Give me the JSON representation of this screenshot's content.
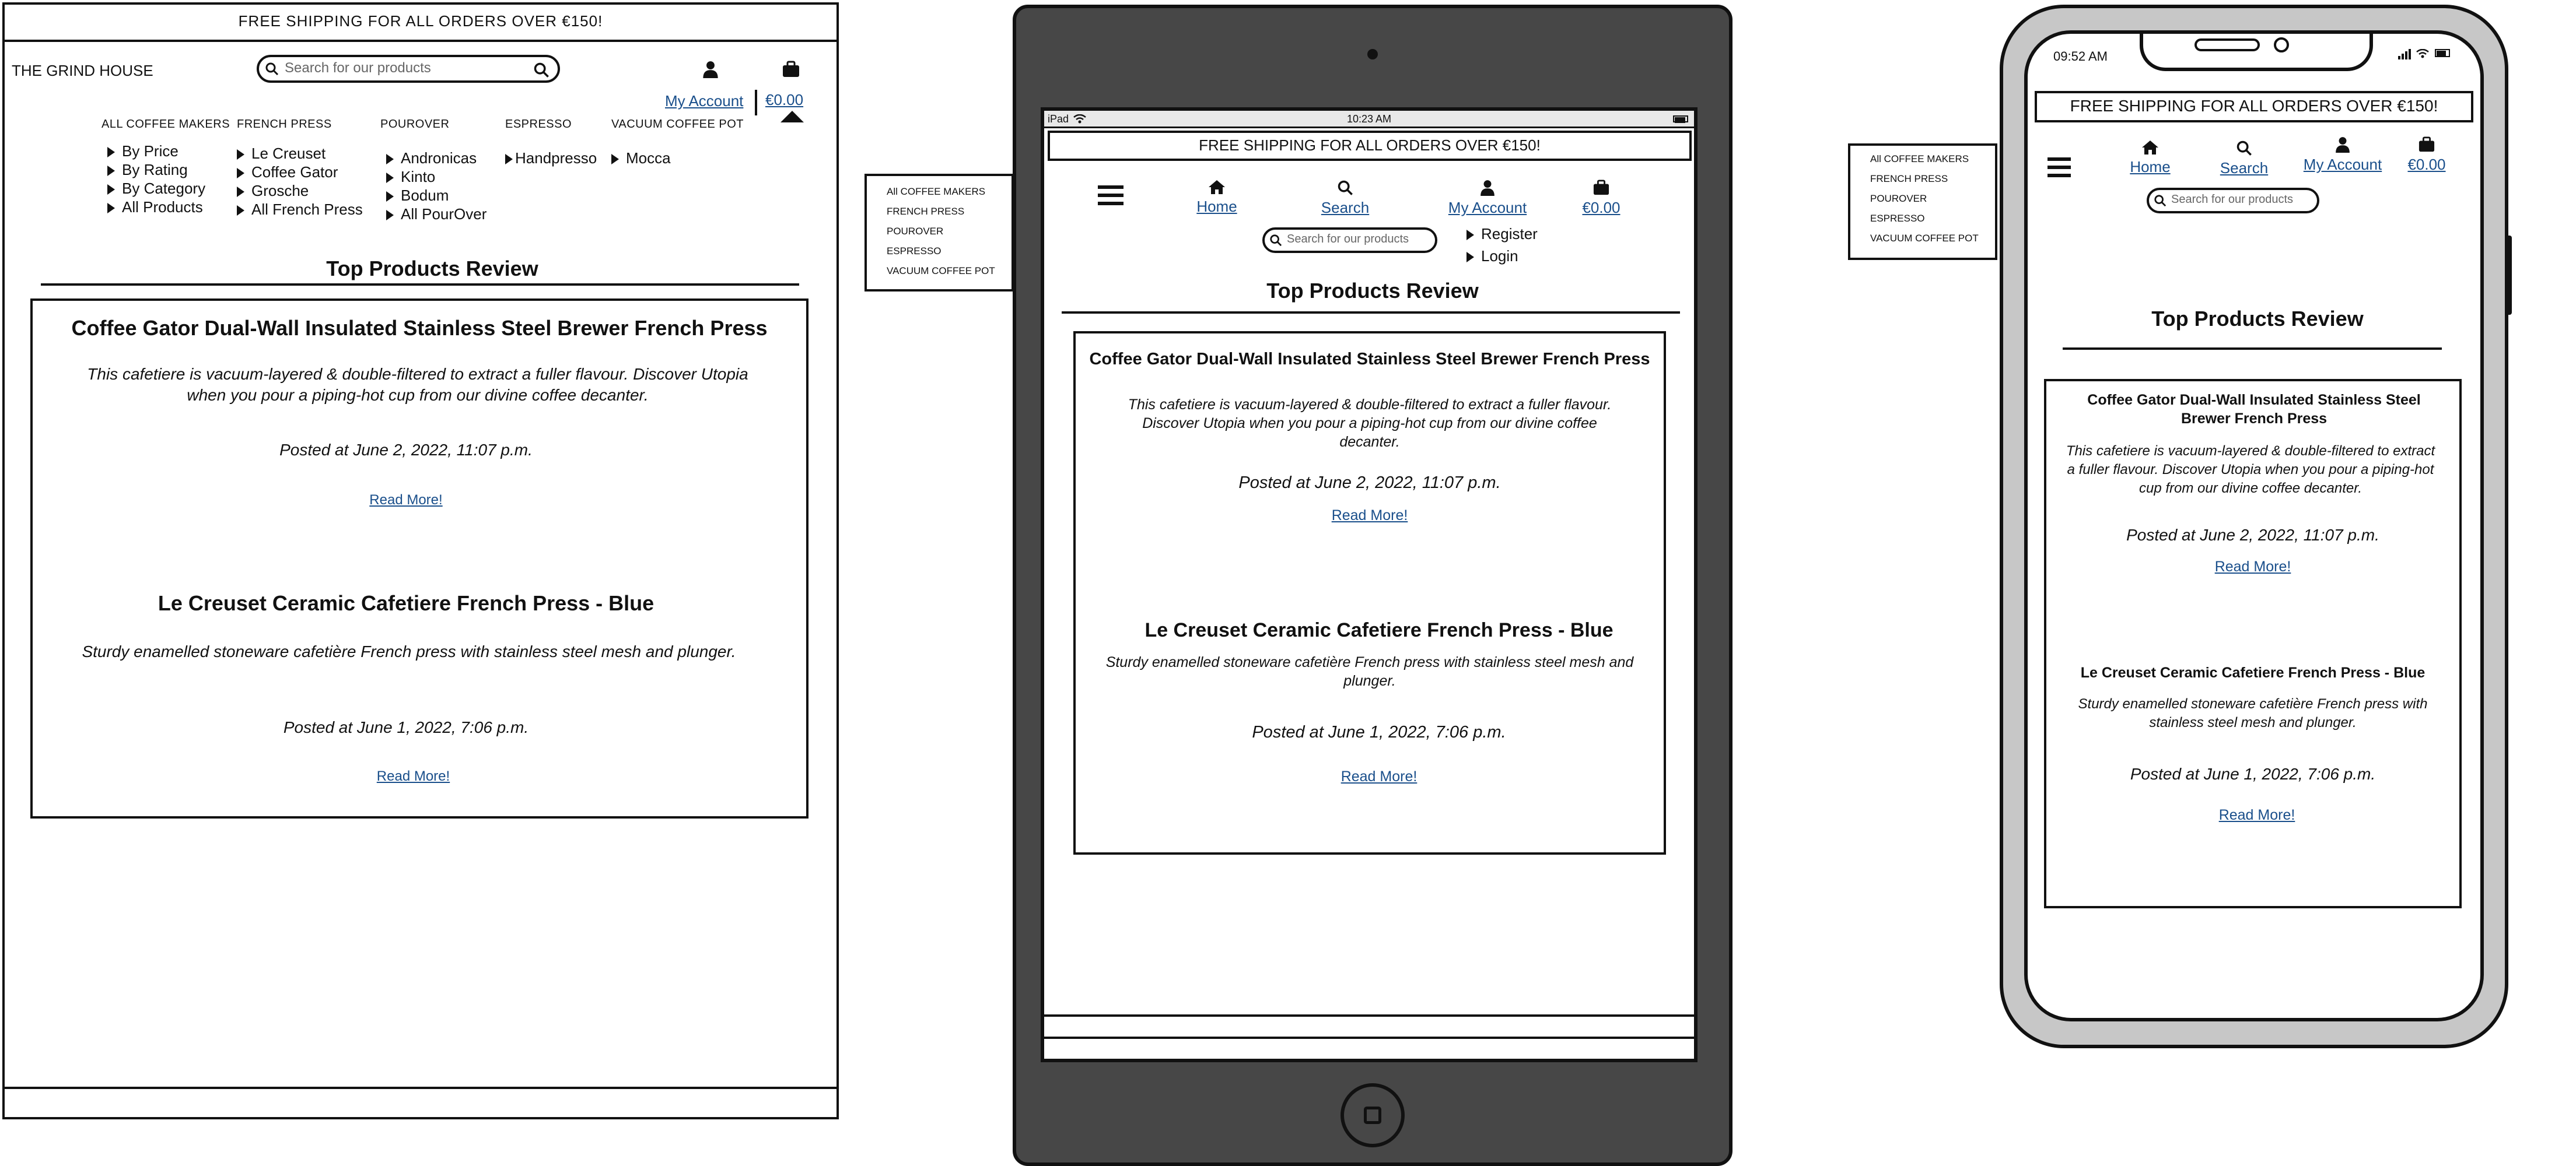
{
  "desktop": {
    "banner": "FREE SHIPPING FOR ALL ORDERS OVER €150!",
    "brand": "THE GRIND HOUSE",
    "search_placeholder": "Search for our products",
    "my_account": "My Account",
    "cart_total": "€0.00",
    "menu": [
      {
        "title": "ALL COFFEE MAKERS",
        "items": [
          "By Price",
          "By Rating",
          "By Category",
          "All Products"
        ]
      },
      {
        "title": "FRENCH PRESS",
        "items": [
          "Le Creuset",
          "Coffee Gator",
          "Grosche",
          "All French Press"
        ]
      },
      {
        "title": "POUROVER",
        "items": [
          "Andronicas",
          "Kinto",
          "Bodum",
          "All PourOver"
        ]
      },
      {
        "title": "ESPRESSO",
        "items": [
          "Handpresso"
        ]
      },
      {
        "title": "VACUUM COFFEE POT",
        "items": [
          "Mocca"
        ]
      }
    ],
    "section_title": "Top Products Review",
    "posts": [
      {
        "title": "Coffee Gator Dual-Wall Insulated Stainless Steel Brewer French Press",
        "body": "This cafetiere is vacuum-layered & double-filtered to extract a fuller flavour. Discover Utopia when you pour a piping-hot cup from our divine coffee decanter.",
        "date": "Posted at June 2, 2022, 11:07 p.m.",
        "read_more": "Read More!"
      },
      {
        "title": "Le Creuset Ceramic Cafetiere French Press - Blue",
        "body": "Sturdy enamelled stoneware cafetière French press with stainless steel mesh and plunger.",
        "date": "Posted at June 1, 2022, 7:06 p.m.",
        "read_more": "Read More!"
      }
    ]
  },
  "tablet_dropdown": [
    "All COFFEE MAKERS",
    "FRENCH PRESS",
    "POUROVER",
    "ESPRESSO",
    "VACUUM COFFEE POT"
  ],
  "tablet": {
    "status_left": "iPad",
    "status_time": "10:23 AM",
    "banner": "FREE SHIPPING FOR ALL ORDERS OVER €150!",
    "nav": {
      "home": "Home",
      "search": "Search",
      "account": "My Account",
      "cart": "€0.00"
    },
    "search_placeholder": "Search for our products",
    "account_menu": [
      "Register",
      "Login"
    ],
    "section_title": "Top Products Review",
    "posts": [
      {
        "title": "Coffee Gator Dual-Wall Insulated Stainless Steel Brewer French Press",
        "body": "This cafetiere is vacuum-layered & double-filtered to extract a fuller flavour. Discover Utopia when you pour a piping-hot cup from our divine coffee decanter.",
        "date": "Posted at June 2, 2022, 11:07 p.m.",
        "read_more": "Read More!"
      },
      {
        "title": "Le Creuset Ceramic Cafetiere French Press - Blue",
        "body": "Sturdy enamelled stoneware cafetière French press with stainless steel mesh and plunger.",
        "date": "Posted at June 1, 2022, 7:06 p.m.",
        "read_more": "Read More!"
      }
    ]
  },
  "phone_dropdown": [
    "All COFFEE MAKERS",
    "FRENCH PRESS",
    "POUROVER",
    "ESPRESSO",
    "VACUUM COFFEE POT"
  ],
  "phone": {
    "status_time": "09:52 AM",
    "banner": "FREE SHIPPING FOR ALL ORDERS OVER €150!",
    "nav": {
      "home": "Home",
      "search": "Search",
      "account": "My Account",
      "cart": "€0.00"
    },
    "search_placeholder": "Search for our products",
    "section_title": "Top Products Review",
    "posts": [
      {
        "title": "Coffee Gator Dual-Wall Insulated Stainless Steel Brewer French Press",
        "body": "This cafetiere is vacuum-layered & double-filtered to extract a fuller flavour. Discover Utopia when you pour a piping-hot cup from our divine coffee decanter.",
        "date": "Posted at June 2, 2022, 11:07 p.m.",
        "read_more": "Read More!"
      },
      {
        "title": "Le Creuset Ceramic Cafetiere French Press - Blue",
        "body": "Sturdy enamelled stoneware cafetière French press with stainless steel mesh and plunger.",
        "date": "Posted at June 1, 2022, 7:06 p.m.",
        "read_more": "Read More!"
      }
    ]
  }
}
